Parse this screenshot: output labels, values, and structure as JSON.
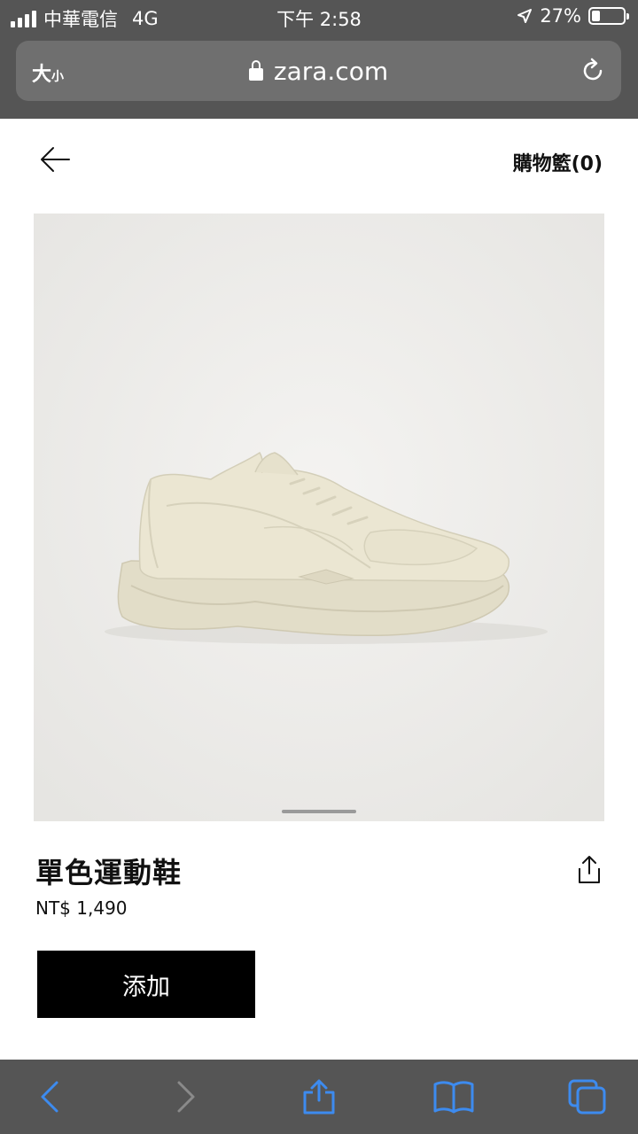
{
  "status_bar": {
    "carrier": "中華電信",
    "network": "4G",
    "time": "下午 2:58",
    "battery": "27%",
    "battery_level": 0.27
  },
  "browser": {
    "text_size_label_big": "大",
    "text_size_label_small": "小",
    "url": "zara.com",
    "icons": [
      "lock-icon",
      "reload-icon"
    ]
  },
  "header": {
    "back_icon": "arrow-left-icon",
    "cart_label": "購物籃(0)"
  },
  "product": {
    "name": "單色運動鞋",
    "price": "NT$ 1,490",
    "add_label": "添加",
    "share_icon": "share-icon"
  },
  "toolbar": {
    "icons": [
      "back-icon",
      "forward-icon",
      "share-icon",
      "bookmarks-icon",
      "tabs-icon"
    ],
    "accent_color": "#3d8bef",
    "disabled_color": "#8a8a8a"
  },
  "colors": {
    "chrome": "#555555",
    "button": "#000000",
    "photo_bg": "#ecebe8",
    "shoe": "#e8e3cf"
  }
}
